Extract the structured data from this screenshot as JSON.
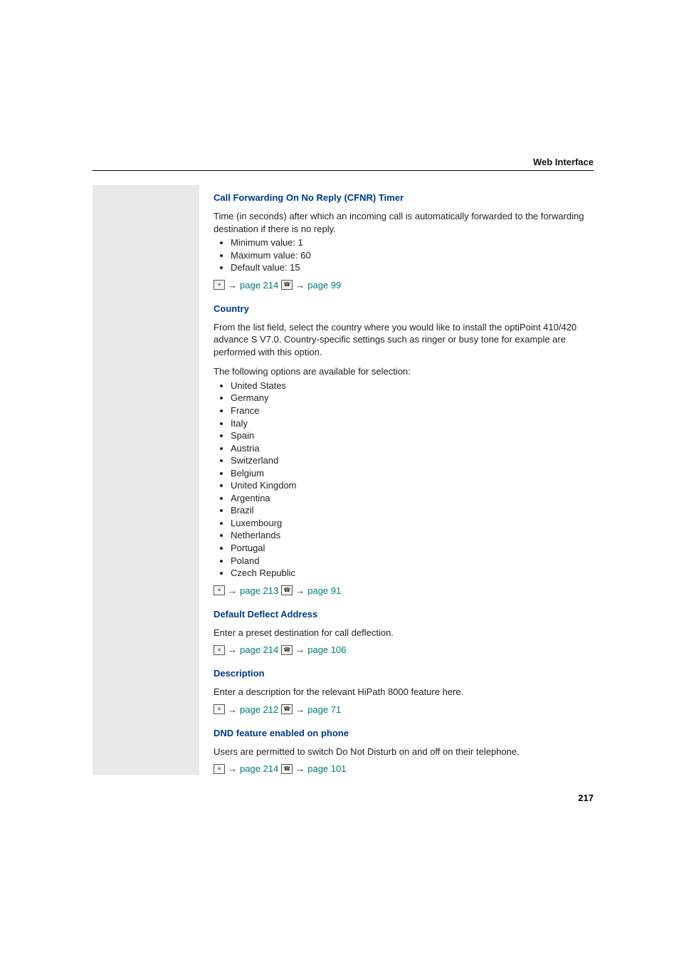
{
  "header": {
    "title": "Web Interface"
  },
  "sections": {
    "cfnr": {
      "title": "Call Forwarding On No Reply (CFNR) Timer",
      "intro": "Time (in seconds) after which an incoming call is automatically forwarded to the forwarding destination if there is no reply.",
      "items": [
        "Minimum value: 1",
        "Maximum value: 60",
        "Default value: 15"
      ],
      "ref1_arrow": "→",
      "ref1_text": "page 214",
      "ref2_arrow": "→",
      "ref2_text": "page 99"
    },
    "country": {
      "title": "Country",
      "intro": "From the list field, select the country where you would like to install the optiPoint 410/420 advance S V7.0. Country-specific settings such as ringer or busy tone for  example are performed with this option.",
      "options_intro": "The following options are available for selection:",
      "items": [
        "United States",
        "Germany",
        "France",
        "Italy",
        "Spain",
        "Austria",
        "Switzerland",
        "Belgium",
        "United Kingdom",
        "Argentina",
        "Brazil",
        "Luxembourg",
        "Netherlands",
        "Portugal",
        "Poland",
        "Czech Republic"
      ],
      "ref1_arrow": "→",
      "ref1_text": "page 213",
      "ref2_arrow": "→",
      "ref2_text": "page 91"
    },
    "deflect": {
      "title": "Default Deflect Address",
      "intro": "Enter a preset destination for call deflection.",
      "ref1_arrow": "→",
      "ref1_text": "page 214",
      "ref2_arrow": "→",
      "ref2_text": "page 106"
    },
    "description": {
      "title": "Description",
      "intro": "Enter a description for the relevant HiPath 8000 feature here.",
      "ref1_arrow": "→",
      "ref1_text": "page 212",
      "ref2_arrow": "→",
      "ref2_text": "page 71"
    },
    "dnd": {
      "title": "DND feature enabled on phone",
      "intro": "Users are permitted to switch Do Not Disturb on and off on their telephone.",
      "ref1_arrow": "→",
      "ref1_text": "page 214",
      "ref2_arrow": "→",
      "ref2_text": "page 101"
    }
  },
  "pageNumber": "217",
  "icons": {
    "web": "≡",
    "phone": "☎"
  }
}
